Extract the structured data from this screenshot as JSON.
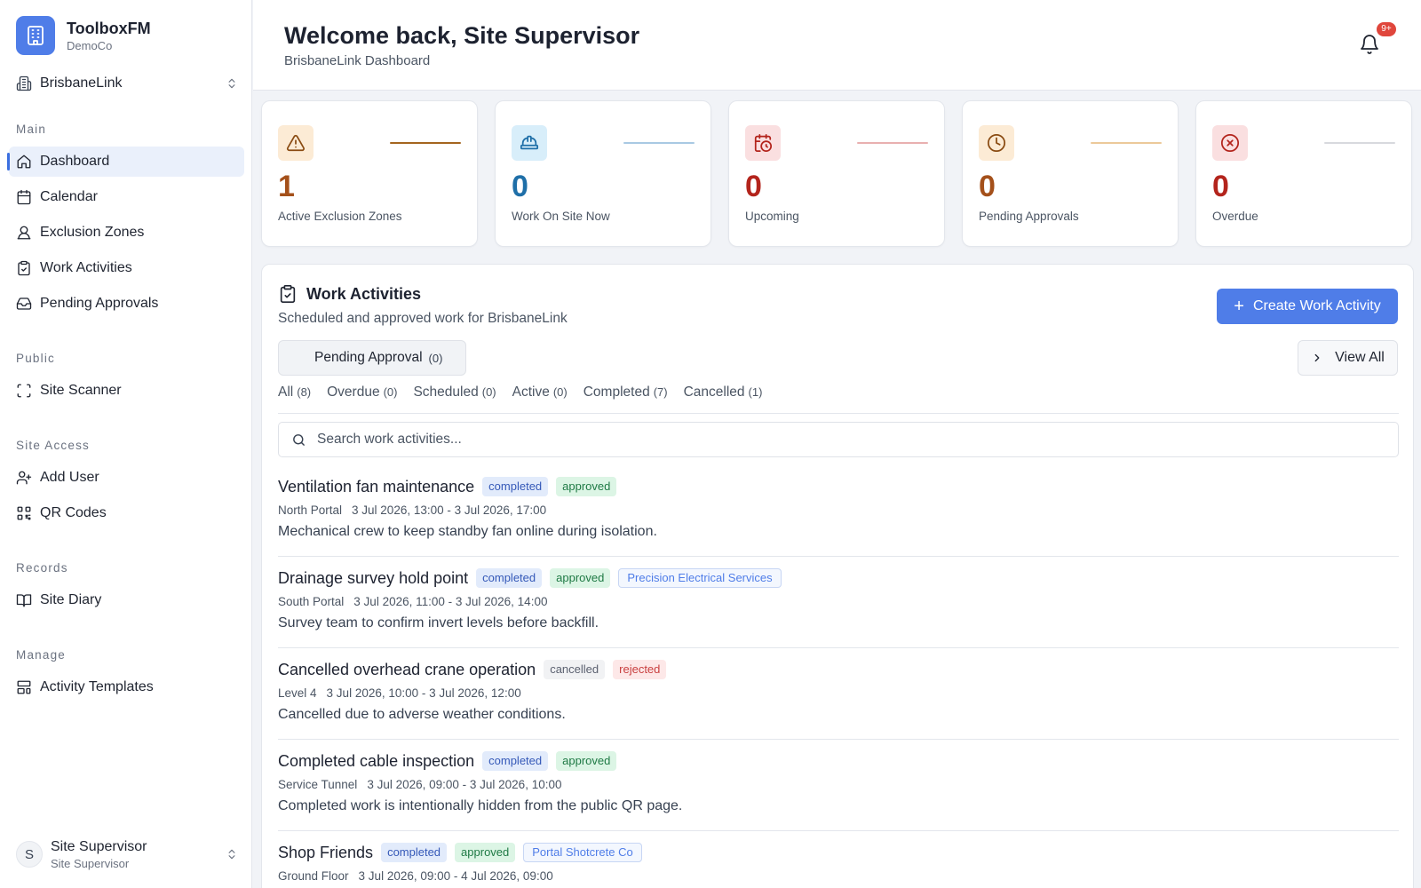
{
  "sidebar": {
    "brand": {
      "name": "ToolboxFM",
      "org": "DemoCo"
    },
    "site": "BrisbaneLink",
    "sections": {
      "main": "Main",
      "public": "Public",
      "site_access": "Site Access",
      "records": "Records",
      "manage": "Manage"
    },
    "items": {
      "dashboard": "Dashboard",
      "calendar": "Calendar",
      "exclusion_zones": "Exclusion Zones",
      "work_activities": "Work Activities",
      "pending_approvals": "Pending Approvals",
      "site_scanner": "Site Scanner",
      "add_user": "Add User",
      "qr_codes": "QR Codes",
      "site_diary": "Site Diary",
      "activity_templates": "Activity Templates"
    },
    "user": {
      "initial": "S",
      "name": "Site Supervisor",
      "role": "Site Supervisor"
    }
  },
  "header": {
    "title": "Welcome back, Site Supervisor",
    "subtitle": "BrisbaneLink Dashboard",
    "notifications_badge": "9+"
  },
  "stats": [
    {
      "value": "1",
      "label": "Active Exclusion Zones",
      "color": "#a4501a",
      "icon": "warning-icon"
    },
    {
      "value": "0",
      "label": "Work On Site Now",
      "color": "#1f6fa8",
      "icon": "hard-hat-icon"
    },
    {
      "value": "0",
      "label": "Upcoming",
      "color": "#b3241c",
      "icon": "calendar-clock-icon"
    },
    {
      "value": "0",
      "label": "Pending Approvals",
      "color": "#a4501a",
      "icon": "clock-icon"
    },
    {
      "value": "0",
      "label": "Overdue",
      "color": "#b3241c",
      "icon": "x-circle-icon"
    }
  ],
  "work": {
    "title": "Work Activities",
    "subtitle": "Scheduled and approved work for BrisbaneLink",
    "create_label": "Create Work Activity",
    "pending_label": "Pending Approval",
    "pending_count": "(0)",
    "view_all_label": "View All",
    "filters": [
      {
        "label": "All",
        "count": "(8)"
      },
      {
        "label": "Overdue",
        "count": "(0)"
      },
      {
        "label": "Scheduled",
        "count": "(0)"
      },
      {
        "label": "Active",
        "count": "(0)"
      },
      {
        "label": "Completed",
        "count": "(7)"
      },
      {
        "label": "Cancelled",
        "count": "(1)"
      }
    ],
    "search_placeholder": "Search work activities...",
    "activities": [
      {
        "name": "Ventilation fan maintenance",
        "status": "completed",
        "approval": "approved",
        "location": "North Portal",
        "when": "3 Jul 2026, 13:00 - 3 Jul 2026, 17:00",
        "description": "Mechanical crew to keep standby fan online during isolation."
      },
      {
        "name": "Drainage survey hold point",
        "status": "completed",
        "approval": "approved",
        "org": "Precision Electrical Services",
        "location": "South Portal",
        "when": "3 Jul 2026, 11:00 - 3 Jul 2026, 14:00",
        "description": "Survey team to confirm invert levels before backfill."
      },
      {
        "name": "Cancelled overhead crane operation",
        "status": "cancelled",
        "approval": "rejected",
        "location": "Level 4",
        "when": "3 Jul 2026, 10:00 - 3 Jul 2026, 12:00",
        "description": "Cancelled due to adverse weather conditions."
      },
      {
        "name": "Completed cable inspection",
        "status": "completed",
        "approval": "approved",
        "location": "Service Tunnel",
        "when": "3 Jul 2026, 09:00 - 3 Jul 2026, 10:00",
        "description": "Completed work is intentionally hidden from the public QR page."
      },
      {
        "name": "Shop Friends",
        "status": "completed",
        "approval": "approved",
        "org": "Portal Shotcrete Co",
        "location": "Ground Floor",
        "when": "3 Jul 2026, 09:00 - 4 Jul 2026, 09:00",
        "description": ""
      }
    ]
  },
  "colors": {
    "accent": "#4f7de8",
    "active_nav_bg": "#eaf0fb",
    "badge_red": "#e0463c"
  }
}
